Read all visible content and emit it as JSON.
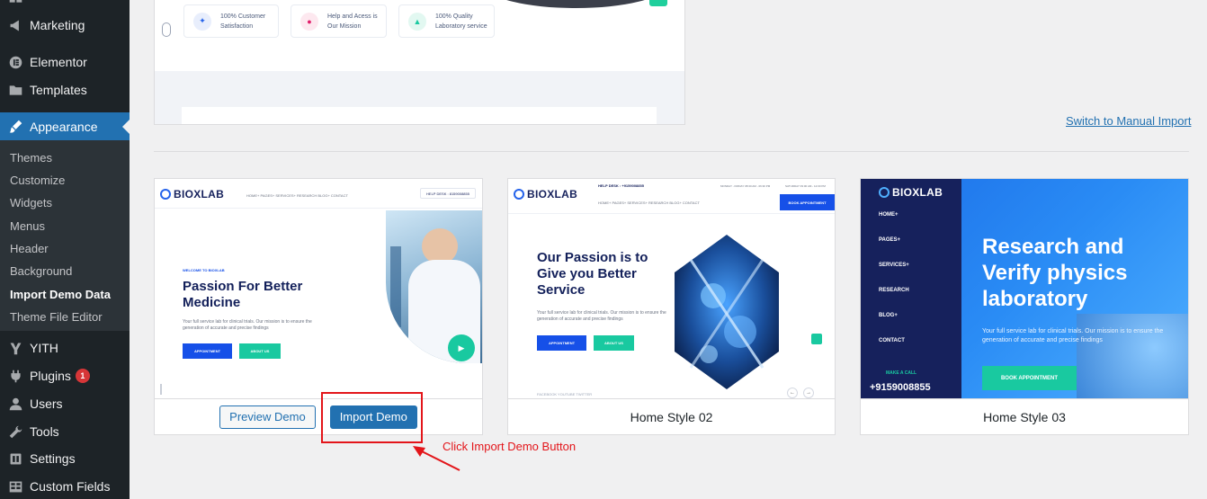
{
  "sidebar": {
    "items": [
      {
        "label": "Marketing",
        "icon": "megaphone-icon"
      },
      {
        "label": "Elementor",
        "icon": "elementor-icon"
      },
      {
        "label": "Templates",
        "icon": "folder-icon"
      },
      {
        "label": "Appearance",
        "icon": "paintbrush-icon"
      },
      {
        "label": "YITH",
        "icon": "yith-icon"
      },
      {
        "label": "Plugins",
        "icon": "plug-icon",
        "badge": "1"
      },
      {
        "label": "Users",
        "icon": "user-icon"
      },
      {
        "label": "Tools",
        "icon": "wrench-icon"
      },
      {
        "label": "Settings",
        "icon": "settings-icon"
      },
      {
        "label": "Custom Fields",
        "icon": "table-icon"
      }
    ],
    "submenu": [
      "Themes",
      "Customize",
      "Widgets",
      "Menus",
      "Header",
      "Background",
      "Import Demo Data",
      "Theme File Editor"
    ]
  },
  "prev_card": {
    "stats": [
      "100% Customer Satisfaction",
      "Help and Acess is Our Mission",
      "100% Quality Laboratory service"
    ]
  },
  "switch_link": "Switch to Manual Import",
  "demos": {
    "d1": {
      "logo": "BIOXLAB",
      "nav": "HOME+      PAGES+      SERVICES+      RESEARCH      BLOG+      CONTACT",
      "helpdesk": "HELP DESK : 8159008855",
      "eyebrow": "WELCOME TO BIOXLAB",
      "title": "Passion For Better Medicine",
      "sub": "Your full service lab for clinical trials. Our mission is to ensure the generation of accurate and precise findings",
      "btn1": "APPOINTMENT",
      "btn2": "ABOUT US",
      "preview": "Preview Demo",
      "import": "Import Demo"
    },
    "d2": {
      "logo": "BIOXLAB",
      "helpdesk": "HELP DESK : +9159008855",
      "hours": "MONDAY - FRIDAY 08:30 AM - 06:30 PM",
      "sat": "SATURDAY 09:00 AM - 12:00 PM",
      "nav": "HOME+      PAGES+      SERVICES+      RESEARCH      BLOG+      CONTACT",
      "book": "BOOK APPOINTMENT",
      "title": "Our Passion is to Give you Better Service",
      "sub": "Your full service lab for clinical trials. Our mission is to ensure the generation of accurate and precise findings",
      "btn1": "APPOINTMENT",
      "btn2": "ABOUT US",
      "social": "FACEBOOK      YOUTUBE      TWITTER",
      "name": "Home Style 02"
    },
    "d3": {
      "logo": "BIOXLAB",
      "nav": [
        "HOME+",
        "PAGES+",
        "SERVICES+",
        "RESEARCH",
        "BLOG+",
        "CONTACT"
      ],
      "call_label": "MAKE A CALL",
      "phone": "+9159008855",
      "title": "Research and Verify physics laboratory",
      "sub": "Your full service lab for clinical trials. Our mission is to ensure the generation of accurate and precise findings",
      "book": "BOOK APPOINTMENT",
      "name": "Home Style 03"
    }
  },
  "annotation": "Click Import Demo Button",
  "colors": {
    "sidebar": "#1d2327",
    "active": "#2271b1",
    "annotation": "#e3151a",
    "brand_navy": "#16215c",
    "brand_blue": "#1650e8",
    "brand_green": "#19c9a0"
  }
}
